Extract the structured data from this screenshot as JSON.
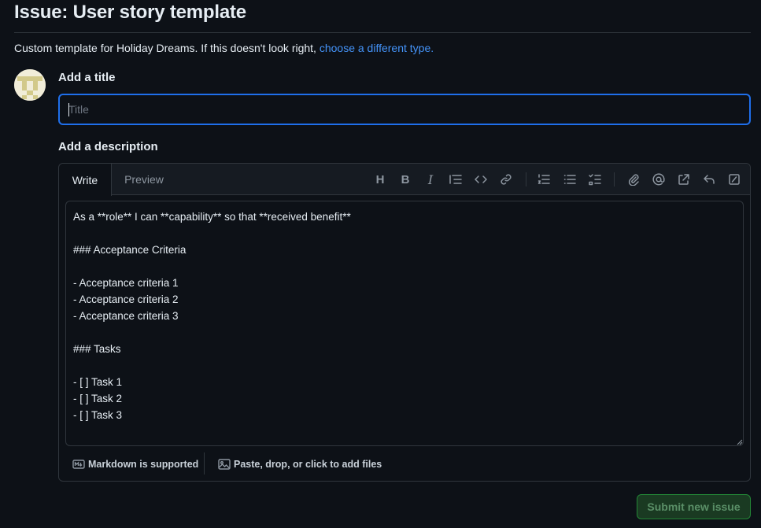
{
  "header": {
    "title": "Issue: User story template",
    "subline_text": "Custom template for Holiday Dreams. If this doesn't look right, ",
    "subline_link": "choose a different type."
  },
  "form": {
    "title_label": "Add a title",
    "title_placeholder": "Title",
    "title_value": "",
    "description_label": "Add a description"
  },
  "editor": {
    "tabs": [
      {
        "label": "Write",
        "active": true
      },
      {
        "label": "Preview",
        "active": false
      }
    ],
    "toolbar_icons": [
      "heading-icon",
      "bold-icon",
      "italic-icon",
      "quote-icon",
      "code-icon",
      "link-icon",
      "numbered-list-icon",
      "unordered-list-icon",
      "task-list-icon",
      "attach-icon",
      "mention-icon",
      "reference-icon",
      "reply-icon",
      "slash-command-icon"
    ],
    "toolbar_heading_glyph": "H",
    "toolbar_bold_glyph": "B",
    "toolbar_italic_glyph": "I",
    "body": "As a **role** I can **capability** so that **received benefit**\n\n### Acceptance Criteria\n\n- Acceptance criteria 1\n- Acceptance criteria 2\n- Acceptance criteria 3\n\n### Tasks\n\n- [ ] Task 1\n- [ ] Task 2\n- [ ] Task 3",
    "footer": {
      "markdown_label": "Markdown is supported",
      "files_label": "Paste, drop, or click to add files"
    }
  },
  "actions": {
    "submit_label": "Submit new issue"
  },
  "colors": {
    "background": "#0d1117",
    "accent_link": "#4493f8",
    "focus_border": "#1f6feb",
    "submit_bg": "#1a3a22"
  }
}
